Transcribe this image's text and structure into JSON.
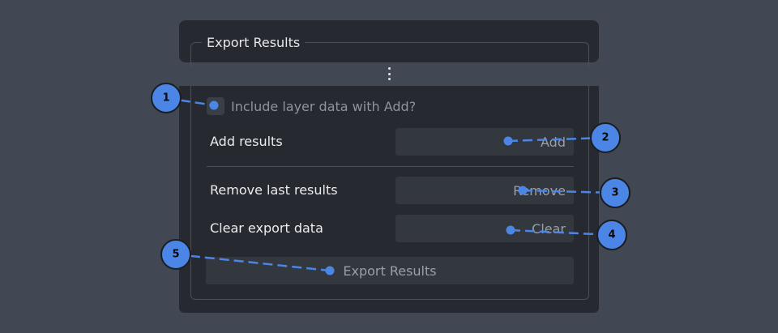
{
  "panel": {
    "title": "Export Results"
  },
  "options": {
    "include_layer_label": "Include layer data with Add?",
    "include_layer_checked": false
  },
  "rows": {
    "add_label": "Add results",
    "add_button": "Add",
    "remove_label": "Remove last results",
    "remove_button": "Remove",
    "clear_label": "Clear export data",
    "clear_button": "Clear",
    "export_button": "Export Results"
  },
  "callouts": [
    "1",
    "2",
    "3",
    "4",
    "5"
  ],
  "colors": {
    "background": "#414753",
    "panel": "#262930",
    "button": "#33373e",
    "callout_fill": "#4b86e6",
    "callout_line": "#4b86e6"
  },
  "icons": {
    "drag_handle": "vertical-ellipsis-icon"
  }
}
